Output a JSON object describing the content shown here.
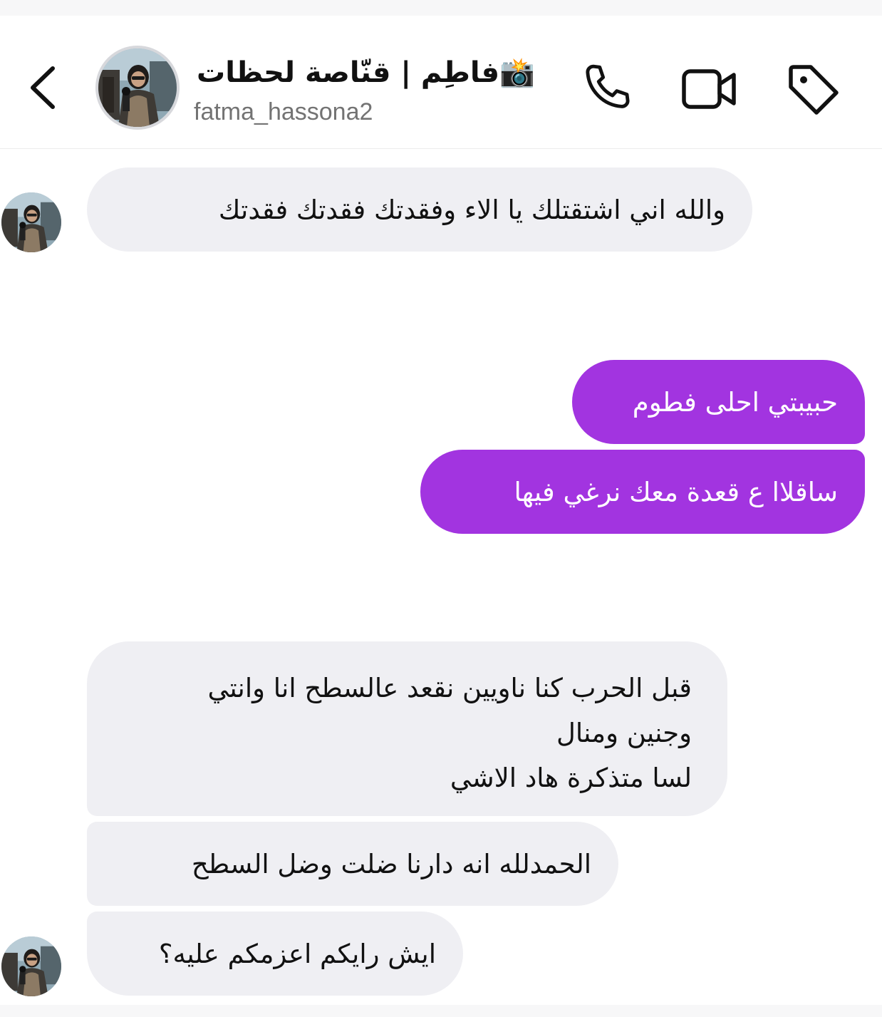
{
  "contact": {
    "display_name": "فاطِم | قنّاصة لحظات📸",
    "username": "fatma_hassona2"
  },
  "header": {
    "back_icon": "chevron-left-icon",
    "call_icon": "phone-icon",
    "video_icon": "video-camera-icon",
    "tag_icon": "tag-icon"
  },
  "messages": [
    {
      "direction": "incoming",
      "text": "والله اني اشتقتلك يا الاء وفقدتك فقدتك فقدتك"
    },
    {
      "direction": "outgoing",
      "text": "حبيبتي احلى فطوم"
    },
    {
      "direction": "outgoing",
      "text": "ساقلاا ع قعدة معك نرغي فيها"
    },
    {
      "direction": "incoming",
      "lines": [
        "قبل الحرب كنا ناويين نقعد عالسطح انا وانتي",
        "وجنين ومنال",
        "لسا متذكرة هاد الاشي"
      ]
    },
    {
      "direction": "incoming",
      "text": "الحمدلله انه دارنا ضلت وضل السطح"
    },
    {
      "direction": "incoming",
      "text": "ايش رايكم اعزمكم عليه؟"
    }
  ],
  "colors": {
    "outgoing_bubble": "#a234e0",
    "incoming_bubble": "#efeff3",
    "text_primary": "#111111",
    "text_secondary": "#737373"
  }
}
